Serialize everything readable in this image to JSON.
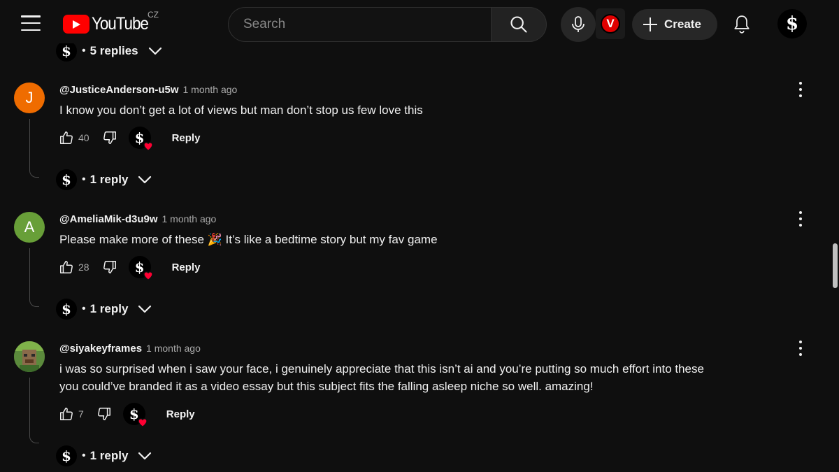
{
  "header": {
    "logo_text": "YouTube",
    "country_code": "CZ",
    "search_placeholder": "Search",
    "create_label": "Create",
    "extension_letter": "V",
    "account_glyph": "$"
  },
  "top_replies": {
    "label": "5 replies",
    "avatar_glyph": "$"
  },
  "comments": [
    {
      "author": "@JusticeAnderson-u5w",
      "time": "1 month ago",
      "avatar_letter": "J",
      "avatar_color": "#ef6c00",
      "text_lines": [
        "I know you don’t get a lot of views but man don’t stop us few love this"
      ],
      "likes": "40",
      "reply_label": "Reply",
      "creator_heart_glyph": "$",
      "replies_label": "1 reply",
      "replies_avatar_glyph": "$"
    },
    {
      "author": "@AmeliaMik-d3u9w",
      "time": "1 month ago",
      "avatar_letter": "A",
      "avatar_color": "#689f38",
      "text_lines": [
        "Please make more of these 🎉 It’s like a bedtime story but my fav game"
      ],
      "likes": "28",
      "reply_label": "Reply",
      "creator_heart_glyph": "$",
      "replies_label": "1 reply",
      "replies_avatar_glyph": "$"
    },
    {
      "author": "@siyakeyframes",
      "time": "1 month ago",
      "avatar_letter": "",
      "avatar_color": "#5b7a3a",
      "text_lines": [
        "i was so surprised when i saw your face, i genuinely appreciate that this isn’t ai and you’re putting so much effort into these",
        "you could’ve branded it as a video essay but this subject fits the falling asleep niche so well. amazing!"
      ],
      "likes": "7",
      "reply_label": "Reply",
      "creator_heart_glyph": "$",
      "replies_label": "1 reply",
      "replies_avatar_glyph": "$"
    }
  ],
  "colors": {
    "background": "#0f0f0f",
    "brand_red": "#ff0000",
    "heart_red": "#ff0033",
    "muted_text": "#aaaaaa"
  }
}
